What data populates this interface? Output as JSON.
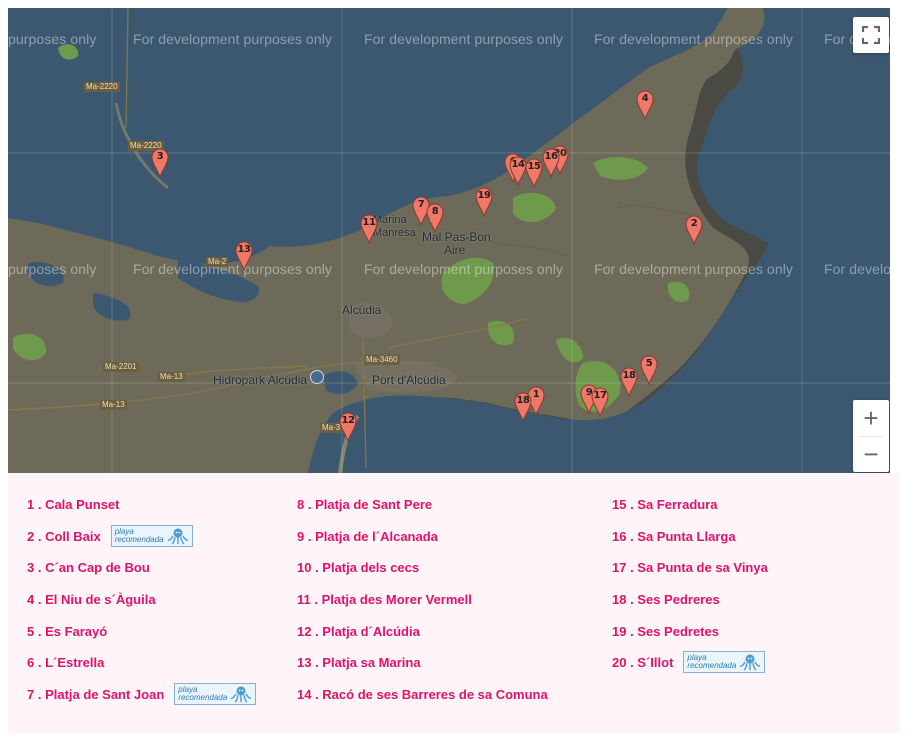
{
  "map": {
    "watermark_text": "For development purposes only",
    "watermark_text_left": "purposes only",
    "watermark_text_right": "For develop",
    "watermark_text_right2": "For developmen",
    "places": {
      "marina": "Marina",
      "manresa": "Manresa",
      "mal_pas": "Mal Pas-Bon",
      "aire": "Aire",
      "alcudia": "Alcúdia",
      "port_alcudia": "Port d'Alcúdia",
      "hidropark": "Hidropark Alcúdia"
    },
    "roads": [
      "Ma-2220",
      "Ma-2220",
      "Ma-3460",
      "Ma-2201",
      "Ma-13",
      "Ma-13",
      "Ma-3",
      "Ma-2"
    ],
    "markers": [
      "1",
      "2",
      "3",
      "4",
      "5",
      "6",
      "7",
      "8",
      "9",
      "10",
      "11",
      "12",
      "13",
      "14",
      "15",
      "16",
      "17",
      "18",
      "19",
      "20"
    ],
    "controls": {
      "fullscreen_icon": "fullscreen-icon",
      "zoom_in": "+",
      "zoom_out": "−"
    },
    "colors": {
      "water": "#3b5870",
      "land": "#6e6a5a",
      "parks": "#6f9a4c",
      "marker": "#f07868"
    }
  },
  "legend": {
    "badge_text": "playa recomendada",
    "col1": [
      {
        "label": "1 . Cala Punset",
        "badge": false
      },
      {
        "label": "2 . Coll Baix",
        "badge": true
      },
      {
        "label": "3 . C´an Cap de Bou",
        "badge": false
      },
      {
        "label": "4 . El Niu de s´Àguila",
        "badge": false
      },
      {
        "label": "5 . Es Farayó",
        "badge": false
      },
      {
        "label": "6 . L´Estrella",
        "badge": false
      },
      {
        "label": "7 . Platja de Sant Joan",
        "badge": true
      }
    ],
    "col2": [
      {
        "label": "8 . Platja de Sant Pere",
        "badge": false
      },
      {
        "label": "9 . Platja de l´Alcanada",
        "badge": false
      },
      {
        "label": "10 . Platja dels cecs",
        "badge": false
      },
      {
        "label": "11 . Platja des Morer Vermell",
        "badge": false
      },
      {
        "label": "12 . Platja d´Alcúdia",
        "badge": false
      },
      {
        "label": "13 . Platja sa Marina",
        "badge": false
      },
      {
        "label": "14 . Racó de ses Barreres de sa Comuna",
        "badge": false
      }
    ],
    "col3": [
      {
        "label": "15 . Sa Ferradura",
        "badge": false
      },
      {
        "label": "16 . Sa Punta Llarga",
        "badge": false
      },
      {
        "label": "17 . Sa Punta de sa Vinya",
        "badge": false
      },
      {
        "label": "18 . Ses Pedreres",
        "badge": false
      },
      {
        "label": "19 . Ses Pedretes",
        "badge": false
      },
      {
        "label": "20 . S´Illot",
        "badge": true
      }
    ]
  }
}
